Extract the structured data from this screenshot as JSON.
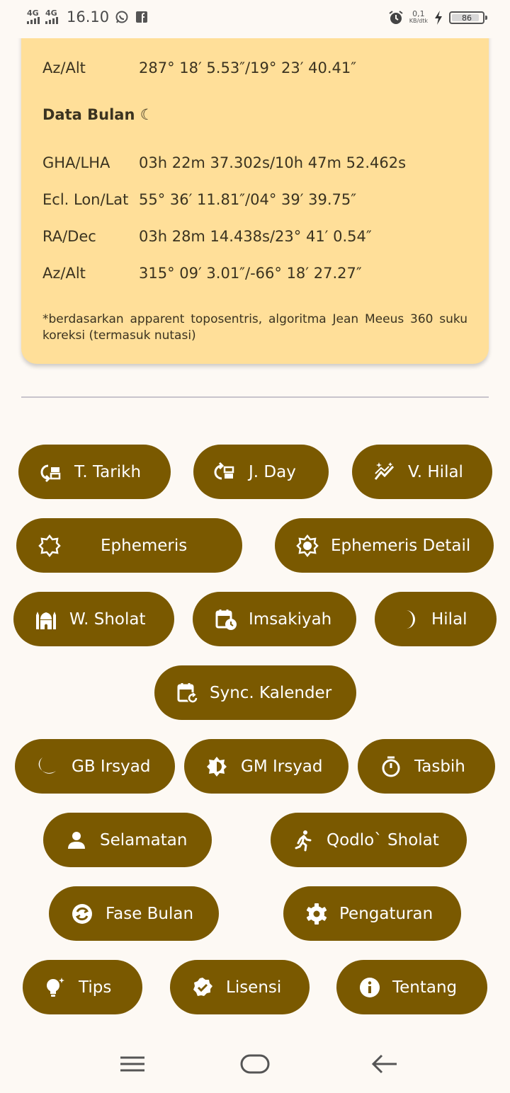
{
  "status_bar": {
    "net1": "4G",
    "net2": "4G",
    "time": "16.10",
    "speed_value": "0,1",
    "speed_unit": "KB/dtk",
    "battery": "86",
    "icons": [
      "whatsapp-icon",
      "facebook-icon",
      "alarm-icon",
      "charging-icon"
    ]
  },
  "sun_data": {
    "rows": [
      {
        "label": "Az/Alt",
        "value": "287° 18′ 5.53″/19° 23′ 40.41″"
      }
    ]
  },
  "moon_data": {
    "title": "Data Bulan ☾",
    "rows": [
      {
        "label": "GHA/LHA",
        "value": "03h 22m 37.302s/10h 47m 52.462s"
      },
      {
        "label": "Ecl. Lon/Lat",
        "value": "55° 36′ 11.81″/04° 39′ 39.75″"
      },
      {
        "label": "RA/Dec",
        "value": "03h 28m 14.438s/23° 41′ 0.54″"
      },
      {
        "label": "Az/Alt",
        "value": "315° 09′ 3.01″/-66° 18′ 27.27″"
      }
    ],
    "note": "*berdasarkan apparent toposentris, algoritma Jean Meeus 360 suku koreksi (termasuk nutasi)"
  },
  "menu": {
    "t_tarikh": "T. Tarikh",
    "j_day": "J. Day",
    "v_hilal": "V. Hilal",
    "ephemeris": "Ephemeris",
    "ephemeris_detail": "Ephemeris Detail",
    "w_sholat": "W. Sholat",
    "imsakiyah": "Imsakiyah",
    "hilal": "Hilal",
    "sync_kalender": "Sync. Kalender",
    "gb_irsyad": "GB Irsyad",
    "gm_irsyad": "GM Irsyad",
    "tasbih": "Tasbih",
    "selamatan": "Selamatan",
    "qodlo_sholat": "Qodlo` Sholat",
    "fase_bulan": "Fase Bulan",
    "pengaturan": "Pengaturan",
    "tips": "Tips",
    "lisensi": "Lisensi",
    "tentang": "Tentang"
  },
  "colors": {
    "card": "#ffdf99",
    "button": "#7a5900",
    "background": "#fdf9f4"
  }
}
